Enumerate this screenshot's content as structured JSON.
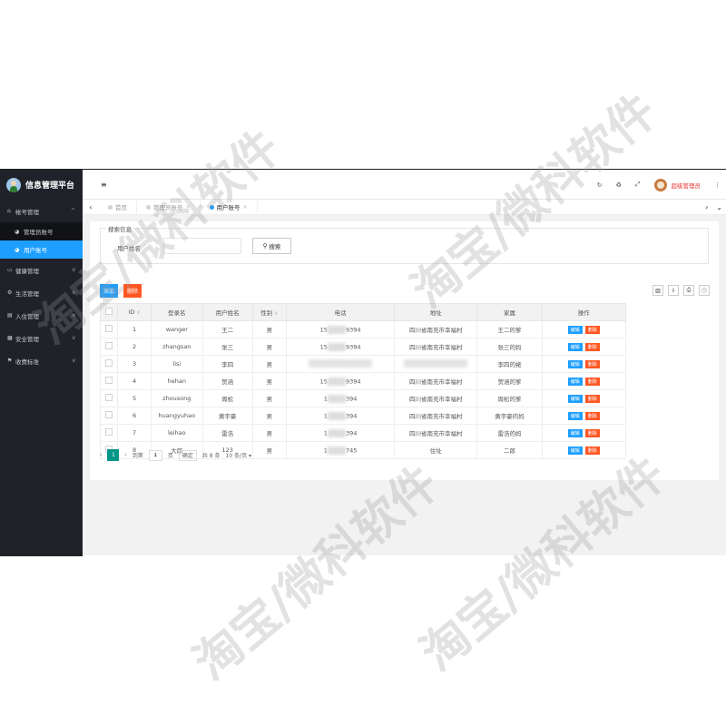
{
  "brand": {
    "title": "信息管理平台"
  },
  "sidebar": {
    "groups": [
      {
        "label": "帐号管理",
        "icon": "home-icon",
        "expanded": true,
        "items": [
          {
            "label": "管理员账号",
            "active": false
          },
          {
            "label": "用户账号",
            "active": true
          }
        ]
      },
      {
        "label": "健康管理",
        "icon": "monitor-icon"
      },
      {
        "label": "生活管理",
        "icon": "gear-icon"
      },
      {
        "label": "入住管理",
        "icon": "doc-icon"
      },
      {
        "label": "安全管理",
        "icon": "calendar-icon"
      },
      {
        "label": "收费标准",
        "icon": "flag-icon"
      }
    ]
  },
  "topbar": {
    "menu_icon": "≡",
    "admin_name": "超级管理员"
  },
  "tabs": [
    {
      "label": "首页",
      "active": false
    },
    {
      "label": "管理员账号",
      "active": false
    },
    {
      "label": "用户账号",
      "active": true
    }
  ],
  "search": {
    "legend": "搜索信息",
    "label": "用户姓名",
    "input_value": "",
    "button_label": "搜索"
  },
  "toolbar": {
    "add_label": "添加",
    "delete_label": "删除"
  },
  "table": {
    "headers": [
      "ID",
      "登录名",
      "用户姓名",
      "性别",
      "电话",
      "地址",
      "家属",
      "操作"
    ],
    "rows": [
      {
        "id": "1",
        "login": "wanger",
        "name": "王二",
        "gender": "男",
        "phone_pre": "15",
        "phone_post": "9394",
        "address": "四川省南充市幸福村",
        "family": "王二的爹"
      },
      {
        "id": "2",
        "login": "zhangsan",
        "name": "张三",
        "gender": "男",
        "phone_pre": "15",
        "phone_post": "9394",
        "address": "四川省南充市幸福村",
        "family": "张三的妈"
      },
      {
        "id": "3",
        "login": "lisi",
        "name": "李四",
        "gender": "男",
        "phone_pre": "",
        "phone_post": "",
        "address": "",
        "family": "李四的姥"
      },
      {
        "id": "4",
        "login": "hehan",
        "name": "贺涵",
        "gender": "男",
        "phone_pre": "15",
        "phone_post": "9394",
        "address": "四川省南充市幸福村",
        "family": "贺涵的爹"
      },
      {
        "id": "5",
        "login": "zhousong",
        "name": "周松",
        "gender": "男",
        "phone_pre": "1",
        "phone_post": "394",
        "address": "四川省南充市幸福村",
        "family": "周松的爹"
      },
      {
        "id": "6",
        "login": "huangyuhao",
        "name": "黄宇豪",
        "gender": "男",
        "phone_pre": "1",
        "phone_post": "394",
        "address": "四川省南充市幸福村",
        "family": "黄宇豪的妈"
      },
      {
        "id": "7",
        "login": "leihao",
        "name": "雷浩",
        "gender": "男",
        "phone_pre": "1",
        "phone_post": "394",
        "address": "四川省南充市幸福村",
        "family": "雷浩的妈"
      },
      {
        "id": "8",
        "login": "大郎",
        "name": "123",
        "gender": "男",
        "phone_pre": "1",
        "phone_post": "745",
        "address": "住址",
        "family": "二郎"
      }
    ],
    "edit_label": "编辑",
    "delete_label": "删除"
  },
  "pager": {
    "current": "1",
    "goto_label": "到第",
    "page_unit": "页",
    "goto_value": "1",
    "confirm_label": "确定",
    "total": "共 8 条",
    "per_page": "10 条/页"
  },
  "watermark": "淘宝/微科软件"
}
